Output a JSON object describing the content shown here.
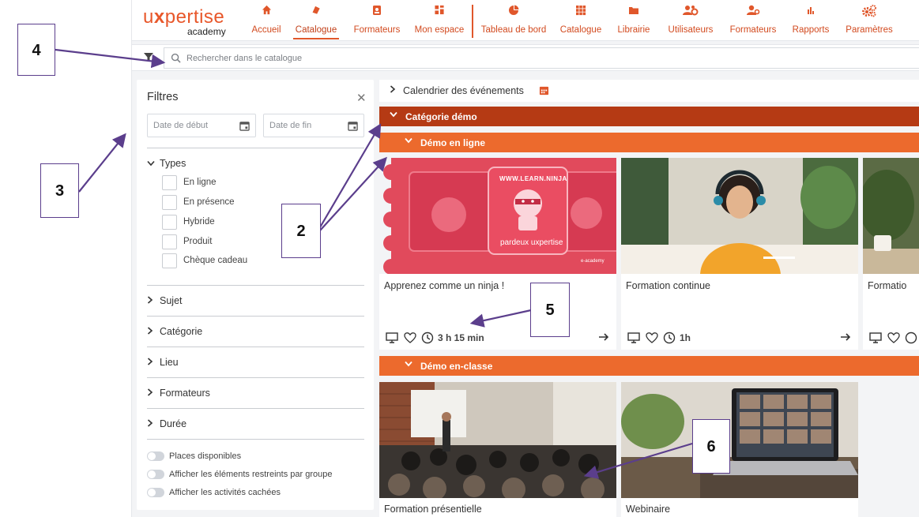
{
  "brand": {
    "logo_main": "uxpertise",
    "logo_sub": "academy"
  },
  "nav": [
    {
      "label": "Accueil",
      "icon": "home-icon"
    },
    {
      "label": "Catalogue",
      "icon": "book-icon",
      "active": true
    },
    {
      "label": "Formateurs",
      "icon": "id-badge-icon"
    },
    {
      "label": "Mon espace",
      "icon": "dashboard-icon"
    },
    {
      "label": "Tableau de bord",
      "icon": "pie-chart-icon"
    },
    {
      "label": "Catalogue",
      "icon": "grid-icon"
    },
    {
      "label": "Librairie",
      "icon": "folder-icon"
    },
    {
      "label": "Utilisateurs",
      "icon": "users-cog-icon"
    },
    {
      "label": "Formateurs",
      "icon": "user-tie-icon"
    },
    {
      "label": "Rapports",
      "icon": "bar-chart-icon"
    },
    {
      "label": "Paramètres",
      "icon": "gears-icon"
    }
  ],
  "search": {
    "placeholder": "Rechercher dans le catalogue"
  },
  "filters": {
    "title": "Filtres",
    "date_start_placeholder": "Date de début",
    "date_end_placeholder": "Date de fin",
    "types_label": "Types",
    "types": [
      "En ligne",
      "En présence",
      "Hybride",
      "Produit",
      "Chèque cadeau"
    ],
    "groups": [
      "Sujet",
      "Catégorie",
      "Lieu",
      "Formateurs",
      "Durée"
    ],
    "toggles": [
      "Places disponibles",
      "Afficher les éléments restreints par groupe",
      "Afficher les activités cachées"
    ]
  },
  "main": {
    "calendar_label": "Calendrier des événements",
    "category": "Catégorie démo",
    "subcategory_online": "Démo en ligne",
    "subcategory_classroom": "Démo en-classe",
    "online_cards": [
      {
        "title": "Apprenez comme un ninja !",
        "duration": "3 h 15 min",
        "image_text_top": "WWW.LEARN.NINJA",
        "image_text_brand": "pardeux uxpertise",
        "image_text_small": "e-academy"
      },
      {
        "title": "Formation continue",
        "duration": "1h"
      },
      {
        "title": "Formatio"
      }
    ],
    "classroom_cards": [
      {
        "title": "Formation présentielle"
      },
      {
        "title": "Webinaire"
      }
    ]
  },
  "annotations": [
    "4",
    "3",
    "2",
    "5",
    "6"
  ],
  "colors": {
    "brand": "#e8572a",
    "category_bar": "#b53a14",
    "subcategory_bar": "#ec6a2d",
    "annotation": "#5b3e8c"
  }
}
